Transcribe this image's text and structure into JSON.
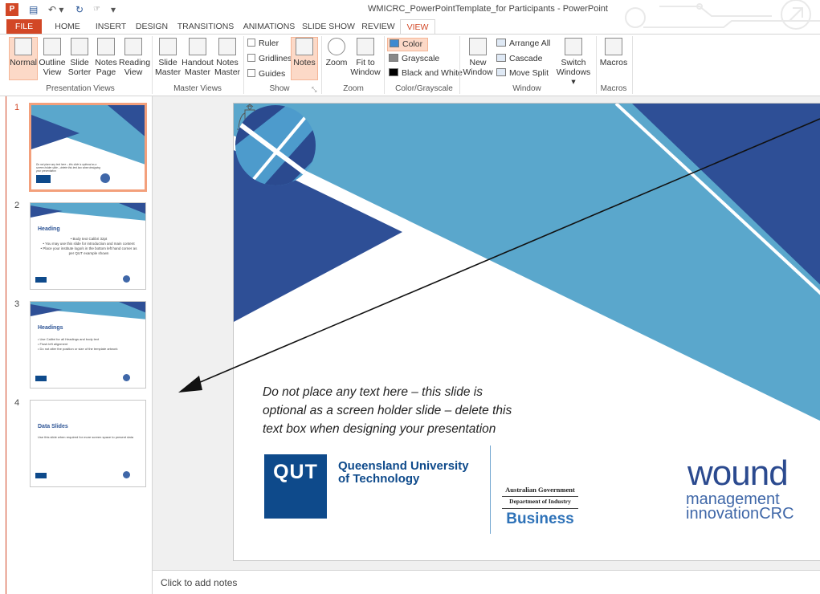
{
  "window": {
    "title": "WMICRC_PowerPointTemplate_for Participants - PowerPoint"
  },
  "tabs": [
    "FILE",
    "HOME",
    "INSERT",
    "DESIGN",
    "TRANSITIONS",
    "ANIMATIONS",
    "SLIDE SHOW",
    "REVIEW",
    "VIEW"
  ],
  "active_tab": "VIEW",
  "ribbon": {
    "presentation_views": {
      "buttons": [
        [
          "Normal",
          ""
        ],
        [
          "Outline",
          "View"
        ],
        [
          "Slide",
          "Sorter"
        ],
        [
          "Notes",
          "Page"
        ],
        [
          "Reading",
          "View"
        ]
      ],
      "label": "Presentation Views"
    },
    "master_views": {
      "buttons": [
        [
          "Slide",
          "Master"
        ],
        [
          "Handout",
          "Master"
        ],
        [
          "Notes",
          "Master"
        ]
      ],
      "label": "Master Views"
    },
    "show": {
      "checks": [
        "Ruler",
        "Gridlines",
        "Guides"
      ],
      "notes_button": "Notes",
      "label": "Show"
    },
    "zoom": {
      "buttons": [
        [
          "Zoom",
          ""
        ],
        [
          "Fit to",
          "Window"
        ]
      ],
      "label": "Zoom"
    },
    "color": {
      "items": [
        "Color",
        "Grayscale",
        "Black and White"
      ],
      "label": "Color/Grayscale"
    },
    "window": {
      "new_window": [
        "New",
        "Window"
      ],
      "items": [
        "Arrange All",
        "Cascade",
        "Move Split"
      ],
      "switch": [
        "Switch",
        "Windows ▾"
      ],
      "label": "Window"
    },
    "macros": {
      "button": "Macros",
      "label": "Macros"
    }
  },
  "slides": [
    {
      "num": "1",
      "caption": "Do not place any text here – this slide is optional as a screen holder slide – delete this text box when designing your presentation"
    },
    {
      "num": "2",
      "heading": "Heading",
      "bullets": [
        "• Body text Calibri 32pt",
        "• You may use this slide for introduction and main content",
        "• Place your institute logo/s in the bottom left hand corner as per QUT example shown"
      ]
    },
    {
      "num": "3",
      "heading": "Headings",
      "bullets": [
        "• Use Calibri for all Headings and body text",
        "• Flush left alignment",
        "• Do not alter the position or size of the template artwork"
      ]
    },
    {
      "num": "4",
      "heading": "Data Slides",
      "bullets": [
        "Use this slide when required for more screen space to present data"
      ]
    }
  ],
  "main_slide": {
    "notice": [
      "Do not place any text here – this slide is",
      "optional as a screen holder slide – delete this",
      "text box when designing your presentation"
    ],
    "qut_box": "QUT",
    "qut_name": [
      "Queensland University",
      "of Technology"
    ],
    "gov": {
      "line1": "Australian Government",
      "line2": "Department of Industry",
      "line3": "Business"
    },
    "wound": {
      "word": "wound",
      "sub1": "management",
      "sub2": "innovation",
      "sub3": "CRC"
    }
  },
  "notes_placeholder": "Click to add notes",
  "colors": {
    "accent": "#d24726",
    "slide_light_blue": "#5aa7cc",
    "slide_dark_blue": "#2e4f96"
  }
}
